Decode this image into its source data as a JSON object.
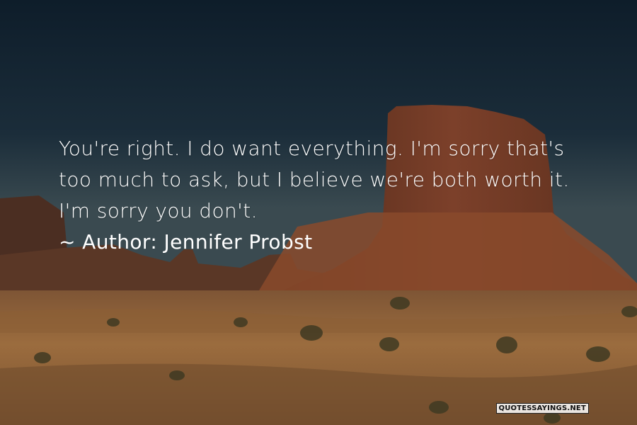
{
  "quote": {
    "lines": [
      "You're right. I do want everything. I'm sorry that's",
      "too much to ask, but I believe we're both worth it.",
      "I'm sorry you don't."
    ],
    "author_prefix": "~ Author:",
    "author_name": "Jennifer Probst"
  },
  "watermark": "QUOTESSAYINGS.NET",
  "colors": {
    "sky_top": "#0f1f2c",
    "sky_horizon": "#2d3e48",
    "butte": "#7a3f28",
    "desert": "#9a6a3c",
    "text": "#ffffff"
  }
}
